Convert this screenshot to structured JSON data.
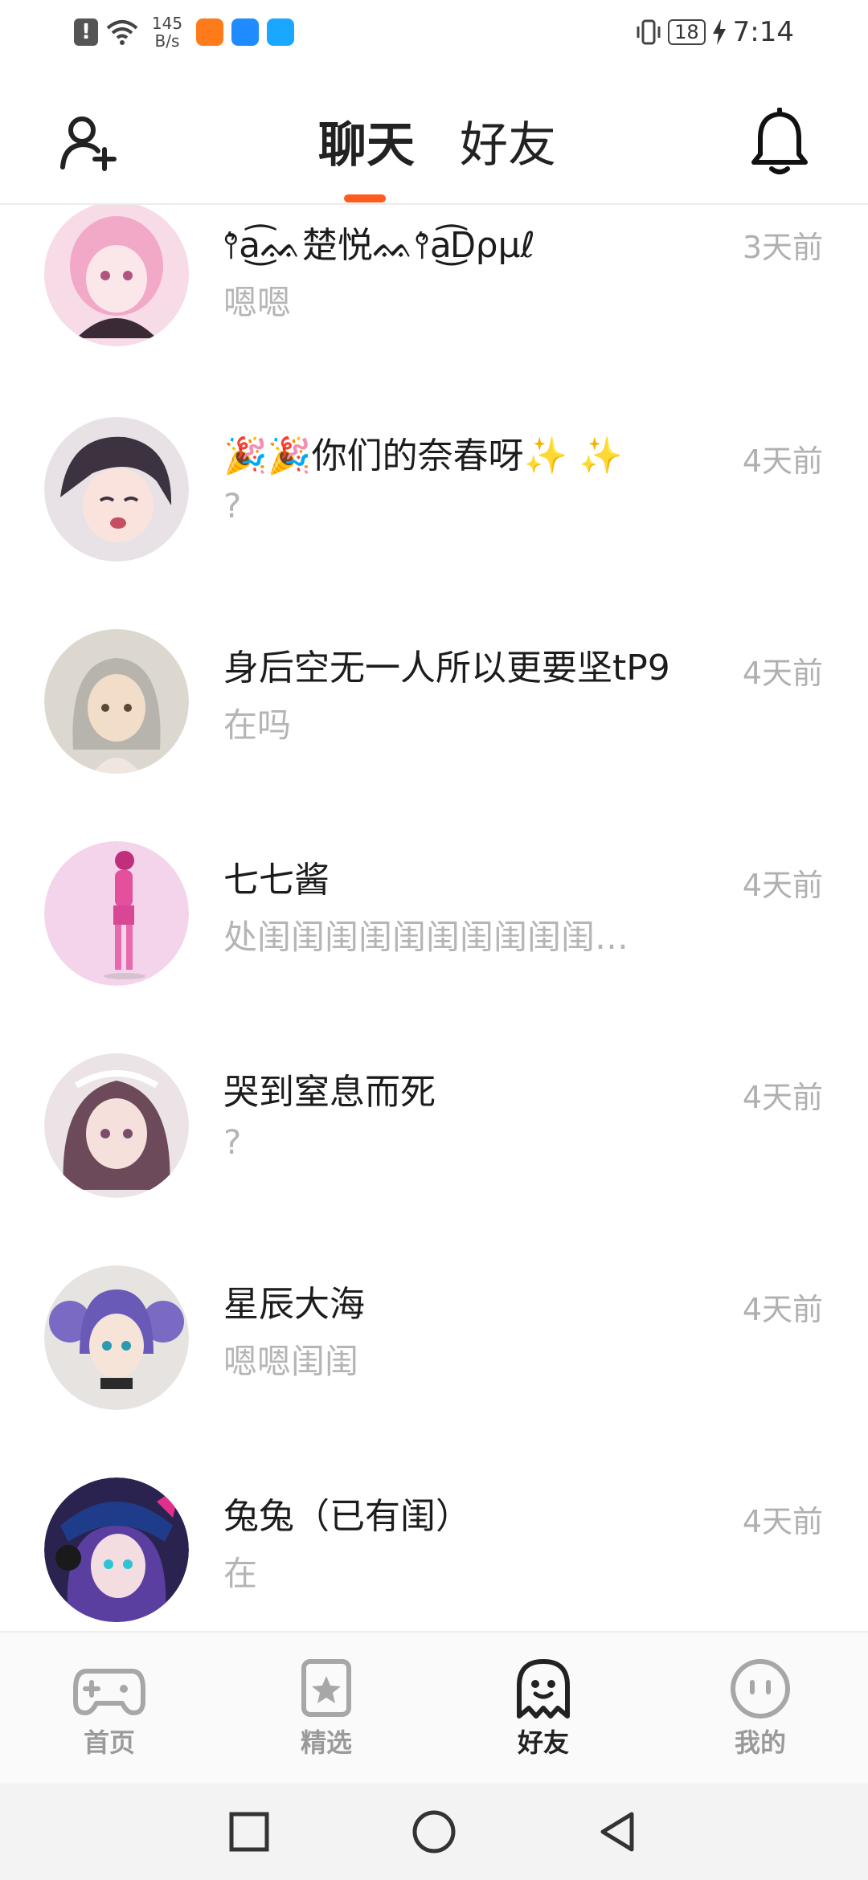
{
  "status_bar": {
    "network_speed_value": "145",
    "network_speed_unit": "B/s",
    "battery": "18",
    "time": "7:14"
  },
  "header": {
    "tab_chat": "聊天",
    "tab_friends": "好友"
  },
  "chats": [
    {
      "name": "⫯͛a͜͡ᨐ楚悦ᨐ⫯͛a͜͡Ꭰρμℓ",
      "message": "嗯嗯",
      "time": "3天前"
    },
    {
      "name": "🎉🎉你们的奈春呀✨ ✨",
      "message": "?",
      "time": "4天前"
    },
    {
      "name": "身后空无一人所以更要坚tP9",
      "message": "在吗",
      "time": "4天前"
    },
    {
      "name": "七七酱",
      "message": "处闺闺闺闺闺闺闺闺闺闺…",
      "time": "4天前"
    },
    {
      "name": "哭到窒息而死",
      "message": "?",
      "time": "4天前"
    },
    {
      "name": "星辰大海",
      "message": "嗯嗯闺闺",
      "time": "4天前"
    },
    {
      "name": "兔兔（已有闺）",
      "message": "在",
      "time": "4天前"
    }
  ],
  "bottom_nav": {
    "home": "首页",
    "featured": "精选",
    "friends": "好友",
    "mine": "我的"
  },
  "colors": {
    "accent": "#ff5a1f",
    "muted_text": "#b5b5b5"
  }
}
